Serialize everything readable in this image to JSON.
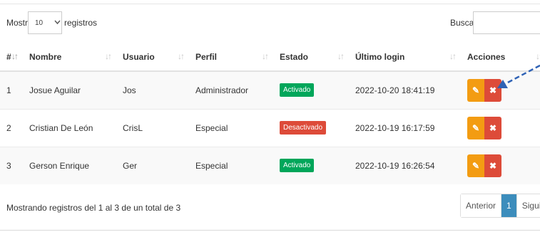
{
  "controls": {
    "show_label": "Mostrar",
    "page_size": "10",
    "records_label": "registros",
    "search_label": "Buscar:",
    "search_value": ""
  },
  "table": {
    "headers": [
      "#",
      "Nombre",
      "Usuario",
      "Perfil",
      "Estado",
      "Último login",
      "Acciones"
    ],
    "rows": [
      {
        "num": "1",
        "nombre": "Josue Aguilar",
        "usuario": "Jos",
        "perfil": "Administrador",
        "estado": "Activado",
        "estado_kind": "on",
        "login": "2022-10-20 18:41:19"
      },
      {
        "num": "2",
        "nombre": "Cristian De León",
        "usuario": "CrisL",
        "perfil": "Especial",
        "estado": "Desactivado",
        "estado_kind": "off",
        "login": "2022-10-19 16:17:59"
      },
      {
        "num": "3",
        "nombre": "Gerson Enrique",
        "usuario": "Ger",
        "perfil": "Especial",
        "estado": "Activado",
        "estado_kind": "on",
        "login": "2022-10-19 16:26:54"
      }
    ]
  },
  "icons": {
    "edit": "pencil-icon",
    "delete": "close-icon",
    "sort": "sort-icon",
    "annotation": "arrow-icon"
  },
  "footer": {
    "info": "Mostrando registros del 1 al 3 de un total de 3"
  },
  "pagination": {
    "previous": "Anterior",
    "current": "1",
    "next": "Siguiente"
  },
  "colors": {
    "activated": "#00a65a",
    "deactivated": "#dd4b39",
    "edit_button": "#f39c12",
    "delete_button": "#dd4b39",
    "pagination_active": "#3c8dbc",
    "annotation_arrow": "#2f62b5"
  }
}
